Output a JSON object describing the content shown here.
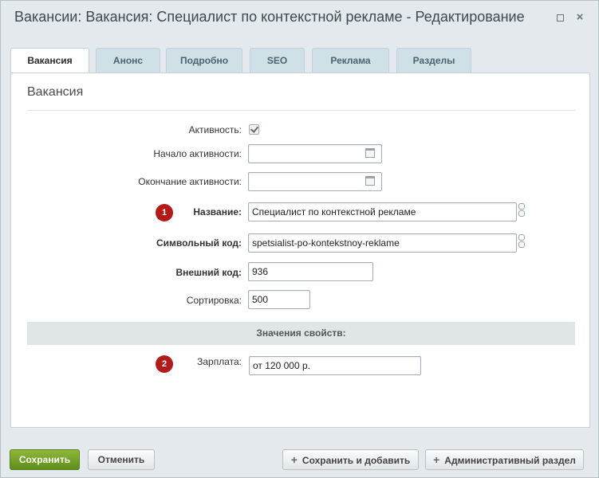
{
  "window": {
    "title": "Вакансии: Вакансия: Специалист по контекстной рекламе - Редактирование",
    "close_glyph": "×"
  },
  "tabs": [
    {
      "label": "Вакансия",
      "active": true
    },
    {
      "label": "Анонс",
      "active": false
    },
    {
      "label": "Подробно",
      "active": false
    },
    {
      "label": "SEO",
      "active": false
    },
    {
      "label": "Реклама",
      "active": false
    },
    {
      "label": "Разделы",
      "active": false
    }
  ],
  "form": {
    "section_title": "Вакансия",
    "active_label": "Активность:",
    "active_checked": true,
    "start_label": "Начало активности:",
    "start_value": "",
    "end_label": "Окончание активности:",
    "end_value": "",
    "name_label": "Название:",
    "name_value": "Специалист по контекстной рекламе",
    "code_label": "Символьный код:",
    "code_value": "spetsialist-po-kontekstnoy-reklame",
    "external_label": "Внешний код:",
    "external_value": "936",
    "sort_label": "Сортировка:",
    "sort_value": "500",
    "props_header": "Значения свойств:",
    "salary_label": "Зарплата:",
    "salary_value": "от 120 000 р."
  },
  "badges": {
    "one": "1",
    "two": "2"
  },
  "buttons": {
    "save": "Сохранить",
    "cancel": "Отменить",
    "save_add": "Сохранить и добавить",
    "admin_section": "Административный раздел",
    "plus_glyph": "+"
  },
  "colors": {
    "save_button": "#6f9e25",
    "badge": "#b31b1b",
    "tab_inactive": "#cfe0e7"
  }
}
